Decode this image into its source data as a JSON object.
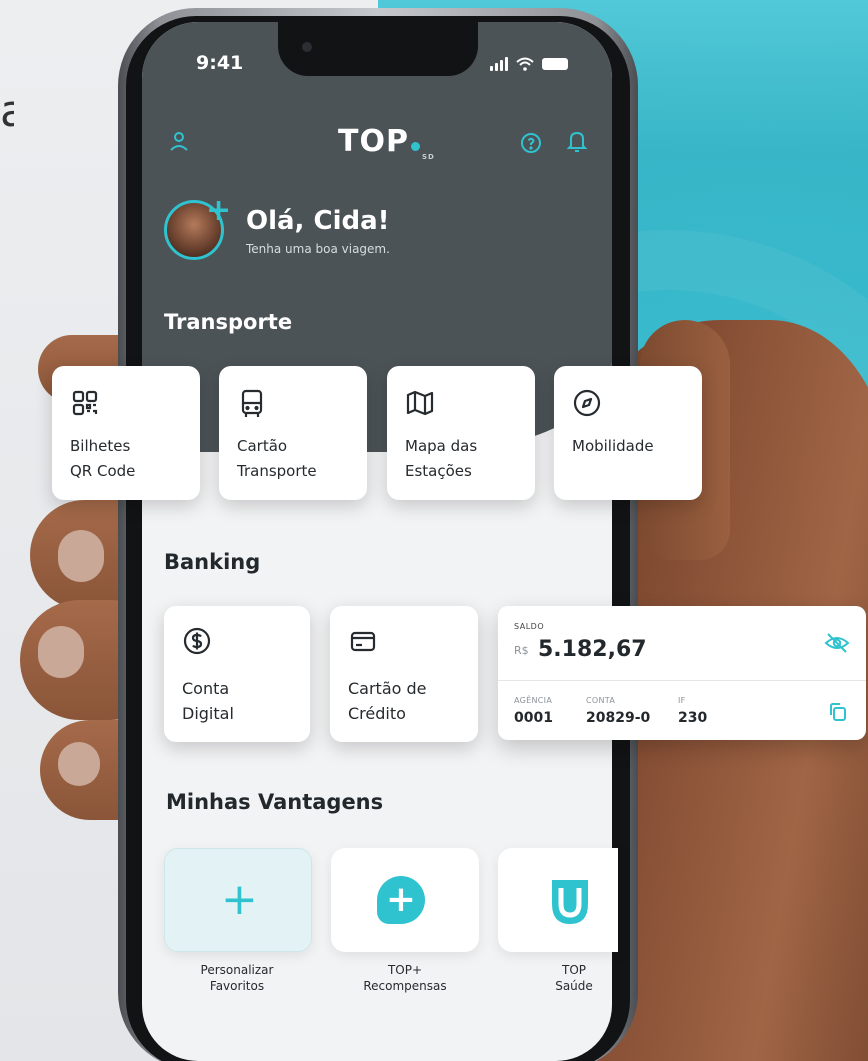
{
  "status_bar": {
    "time": "9:41"
  },
  "header": {
    "logo": "TOP",
    "logo_sub": "SD"
  },
  "greeting": {
    "title": "Olá, Cida!",
    "subtitle": "Tenha uma boa viagem."
  },
  "transporte": {
    "title": "Transporte",
    "items": [
      {
        "label_1": "Bilhetes",
        "label_2": "QR Code",
        "icon": "qr-code-icon"
      },
      {
        "label_1": "Cartão",
        "label_2": "Transporte",
        "icon": "bus-icon"
      },
      {
        "label_1": "Mapa das",
        "label_2": "Estações",
        "icon": "map-icon"
      },
      {
        "label_1": "Mobilidade",
        "label_2": "",
        "icon": "compass-icon"
      }
    ]
  },
  "banking": {
    "title": "Banking",
    "items": [
      {
        "label_1": "Conta",
        "label_2": "Digital",
        "icon": "dollar-icon"
      },
      {
        "label_1": "Cartão de",
        "label_2": "Crédito",
        "icon": "credit-card-icon"
      }
    ],
    "saldo": {
      "label": "SALDO",
      "currency": "R$",
      "value": "5.182,67",
      "agencia_label": "AGÊNCIA",
      "agencia": "0001",
      "conta_label": "CONTA",
      "conta": "20829-0",
      "if_label": "IF",
      "if": "230"
    }
  },
  "vantagens": {
    "title": "Minhas Vantagens",
    "items": [
      {
        "label_1": "Personalizar",
        "label_2": "Favoritos"
      },
      {
        "label_1": "TOP+",
        "label_2": "Recompensas"
      },
      {
        "label_1": "TOP",
        "label_2": "Saúde"
      }
    ]
  },
  "colors": {
    "accent": "#2fc2cf",
    "header_bg": "#4c5357",
    "screen_bg": "#f2f3f4",
    "text": "#23282c"
  }
}
